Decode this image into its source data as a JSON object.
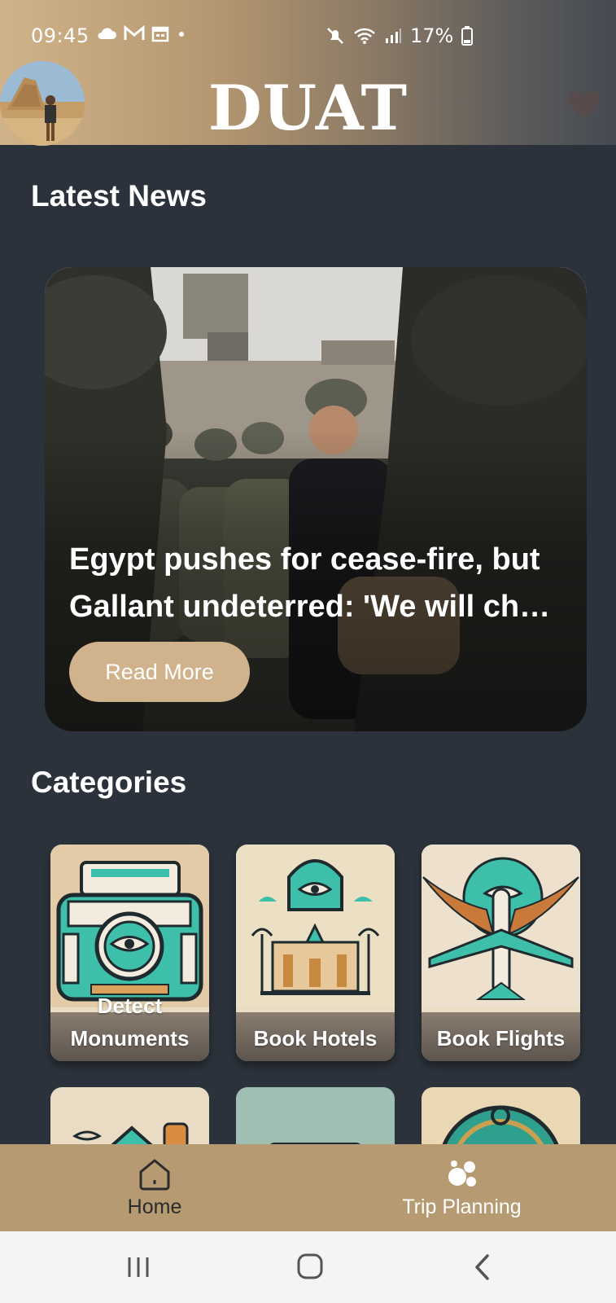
{
  "status_bar": {
    "time": "09:45",
    "battery": "17%",
    "left_icons": [
      "cloud-icon",
      "gmail-icon",
      "calendar-icon",
      "dot-icon"
    ],
    "right_icons": [
      "mute-icon",
      "wifi-icon",
      "signal-icon",
      "battery-icon"
    ]
  },
  "header": {
    "app_title": "DUAT",
    "avatar_icon": "user-avatar",
    "favorite_icon": "heart-icon"
  },
  "news": {
    "section_title": "Latest News",
    "headline": "Egypt pushes for cease-fire, but Gallant undeterred: 'We will ch…",
    "read_more_label": "Read More"
  },
  "categories": {
    "section_title": "Categories",
    "items": [
      {
        "label_line1": "Detect",
        "label_line2": "Monuments",
        "icon": "monument-scanner-icon"
      },
      {
        "label_line1": "",
        "label_line2": "Book Hotels",
        "icon": "hotel-icon"
      },
      {
        "label_line1": "",
        "label_line2": "Book Flights",
        "icon": "airplane-icon"
      }
    ]
  },
  "bottom_nav": {
    "items": [
      {
        "label": "Home",
        "icon": "home-icon"
      },
      {
        "label": "Trip Planning",
        "icon": "trip-planning-icon"
      }
    ]
  },
  "colors": {
    "background": "#2c323b",
    "accent": "#d0b38d",
    "nav_background": "#b59a72",
    "teal": "#3dbfaa"
  }
}
